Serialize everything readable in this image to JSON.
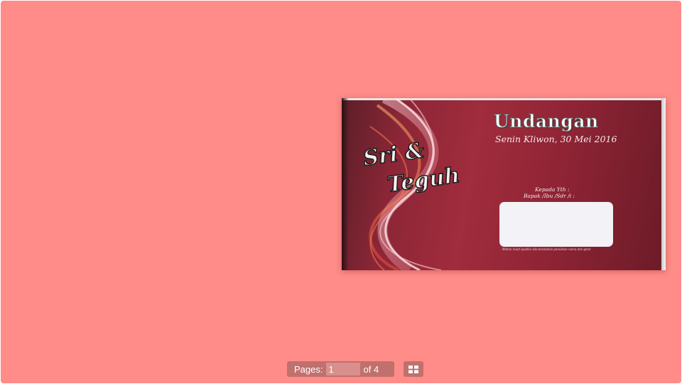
{
  "viewer": {
    "background_color": "#ff8c88",
    "toolbar_color": "#c0706d"
  },
  "page_content": {
    "title": "Undangan",
    "date": "Senin Kliwon, 30 Mei 2016",
    "name_first": "Sri &",
    "name_second": "Teguh",
    "recipient_line": "Kepada Yth :",
    "recipient_salutation": "Bapak /Ibu /Sdr /i :",
    "footnote": "Mohon maaf apabila ada kesalahan penulisan nama dan gelar"
  },
  "toolbar": {
    "pages_label": "Pages:",
    "current_page": "1",
    "total_label": "of 4",
    "grid_icon": "grid-view-icon"
  }
}
